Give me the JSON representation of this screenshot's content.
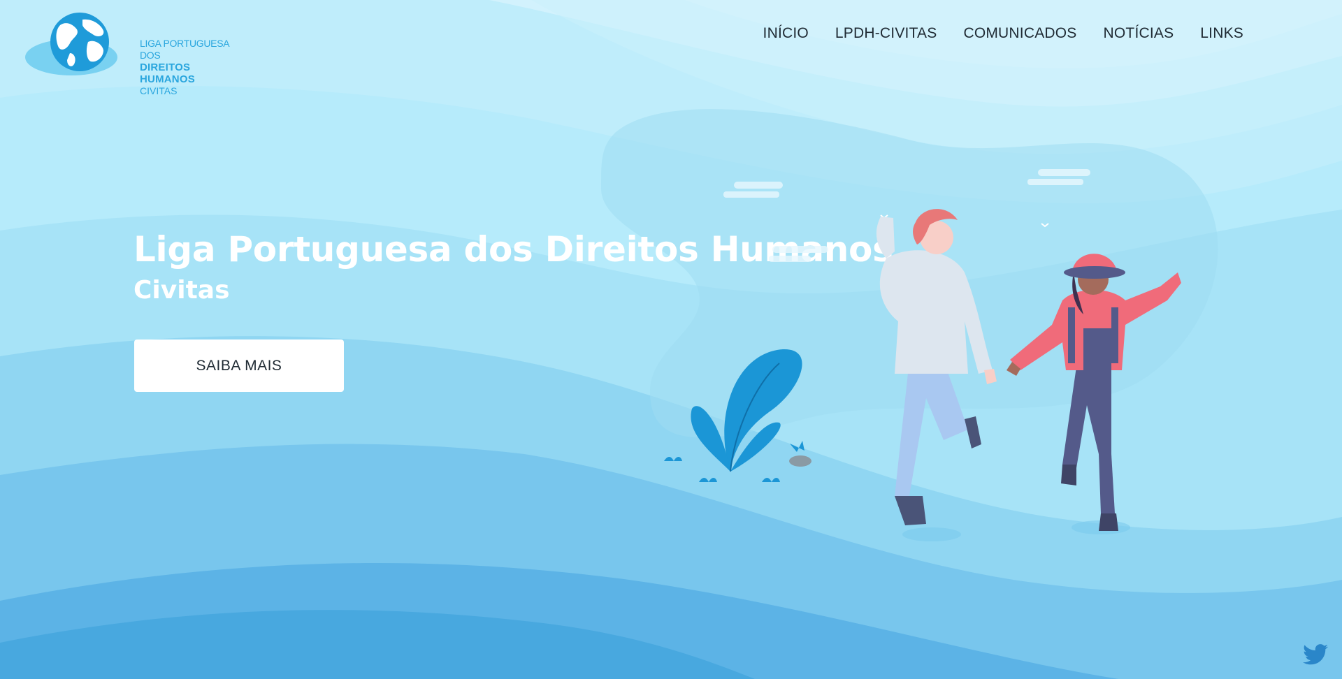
{
  "logo": {
    "line1": "LIGA PORTUGUESA DOS",
    "line2": "DIREITOS HUMANOS",
    "line3": "CIVITAS"
  },
  "nav": {
    "items": [
      {
        "label": "INÍCIO"
      },
      {
        "label": "LPDH-CIVITAS"
      },
      {
        "label": "COMUNICADOS"
      },
      {
        "label": "NOTÍCIAS"
      },
      {
        "label": "LINKS"
      }
    ]
  },
  "hero": {
    "title": "Liga Portuguesa dos Direitos Humanos",
    "subtitle": "Civitas",
    "cta_label": "SAIBA MAIS"
  },
  "social": {
    "icon": "twitter-icon"
  },
  "colors": {
    "brand": "#2aa6de",
    "sky_light": "#d7f3fc",
    "wave_mid": "#8fd0ef",
    "wave_deep": "#49a9e0",
    "text_dark": "#1f2a33",
    "accent_coral": "#f06b7a"
  }
}
